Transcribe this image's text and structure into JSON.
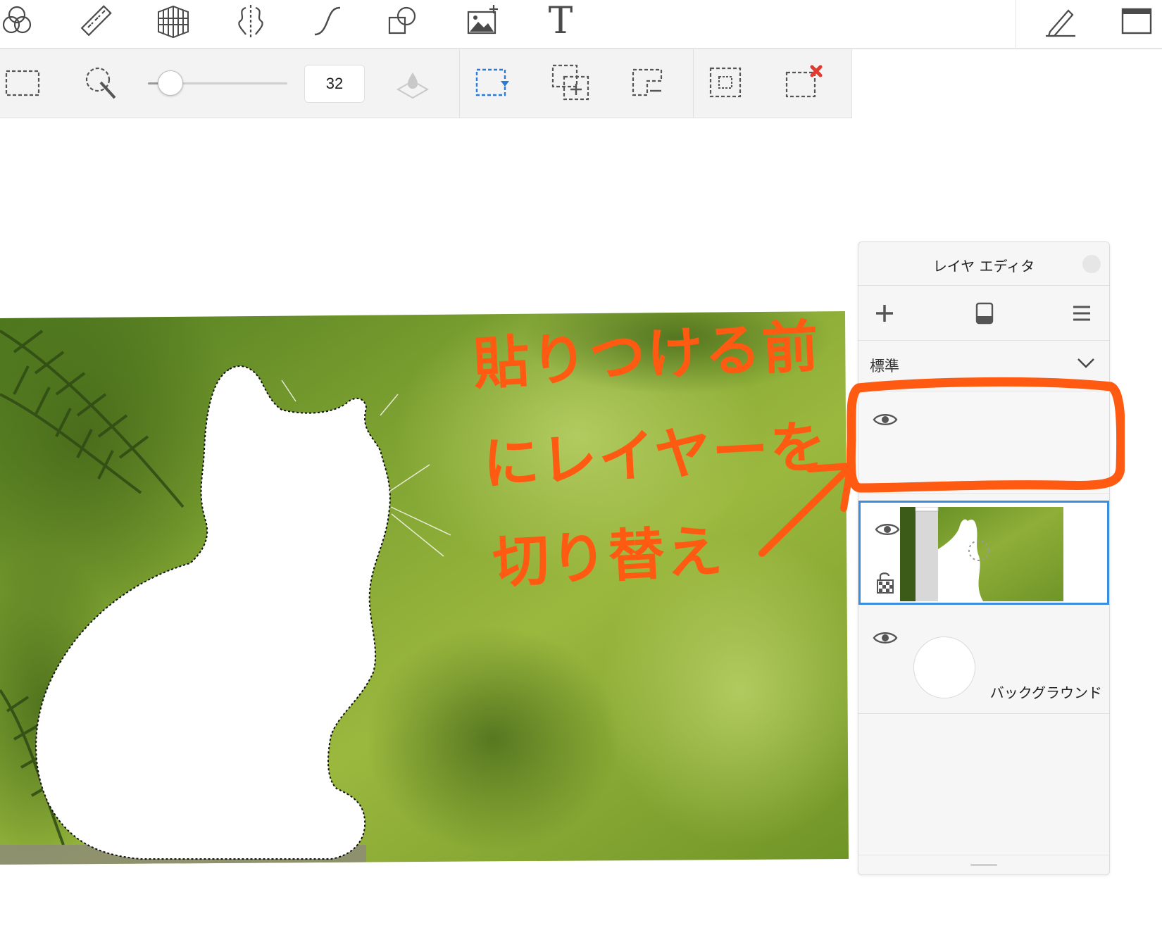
{
  "toolbar": {
    "tools": [
      {
        "name": "blend-mode-icon"
      },
      {
        "name": "ruler-icon"
      },
      {
        "name": "perspective-grid-icon"
      },
      {
        "name": "symmetry-icon"
      },
      {
        "name": "curve-icon"
      },
      {
        "name": "shapes-icon"
      },
      {
        "name": "add-image-icon"
      },
      {
        "name": "text-icon",
        "glyph": "T"
      }
    ],
    "right": [
      {
        "name": "pen-settings-icon"
      },
      {
        "name": "window-icon"
      }
    ]
  },
  "options": {
    "brush_size": "32",
    "brush_size_level": 0.16
  },
  "annotation": {
    "line1": "貼りつける前",
    "line2": "にレイヤーを",
    "line3": "切り替え",
    "color": "#ff5a12"
  },
  "layer_panel": {
    "title": "レイヤ エディタ",
    "blend_mode": "標準",
    "layers": [
      {
        "name": "",
        "visible": true,
        "selected": false
      },
      {
        "name": "",
        "visible": true,
        "selected": true
      },
      {
        "name": "バックグラウンド",
        "visible": true,
        "selected": false
      }
    ]
  },
  "colors": {
    "accent_blue": "#3c8cdf",
    "annotation_orange": "#ff5a12",
    "panel_bg": "#f6f6f6"
  }
}
